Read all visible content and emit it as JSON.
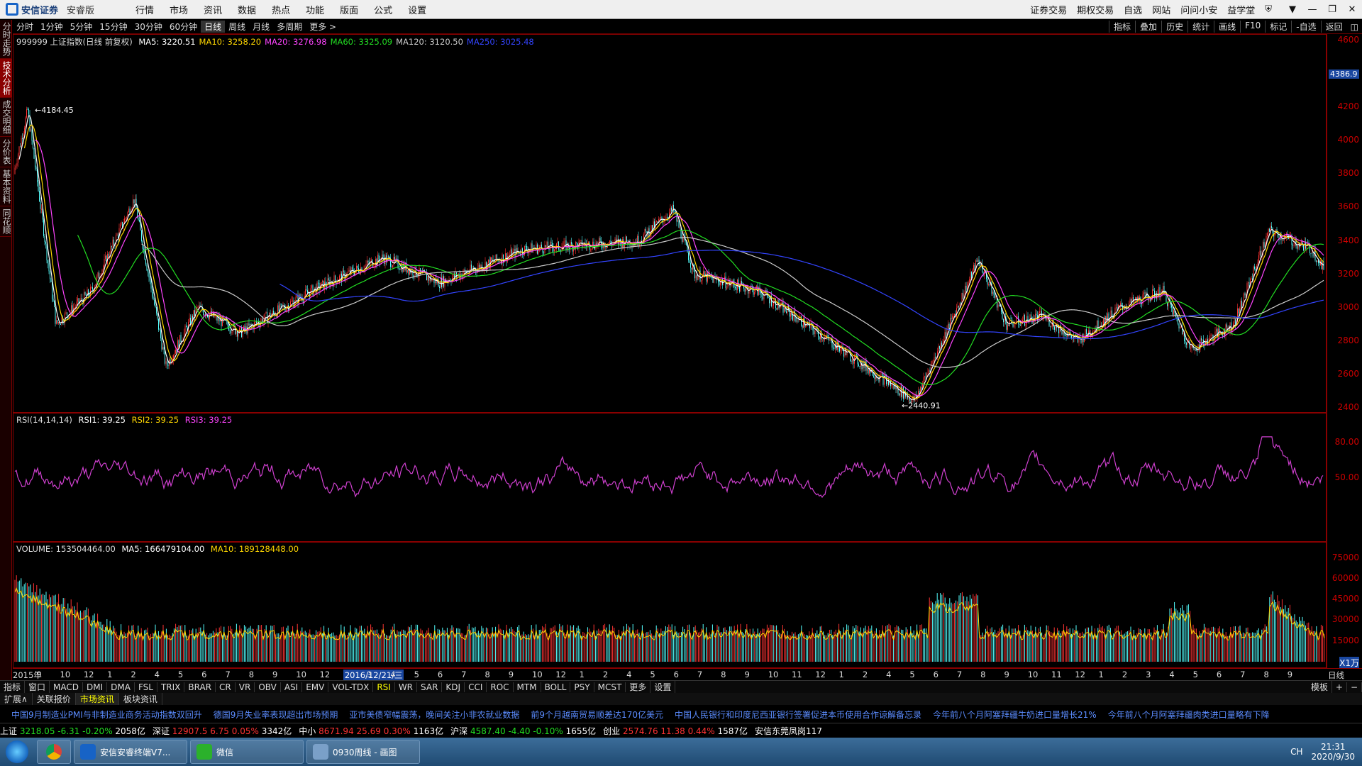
{
  "menubar": {
    "brand": "安信证券",
    "edition": "安睿版",
    "items": [
      "行情",
      "市场",
      "资讯",
      "数据",
      "热点",
      "功能",
      "版面",
      "公式",
      "设置"
    ],
    "right_items": [
      "证券交易",
      "期权交易",
      "自选",
      "网站",
      "问问小安",
      "益学堂"
    ],
    "window_controls": [
      "▼",
      "—",
      "❐",
      "✕"
    ]
  },
  "sidetabs": [
    {
      "label": "分时走势"
    },
    {
      "label": "技术分析",
      "active": true
    },
    {
      "label": "成交明细"
    },
    {
      "label": "分价表"
    },
    {
      "label": "基本资料"
    },
    {
      "label": "同花顺"
    }
  ],
  "periods": {
    "items": [
      "分时",
      "1分钟",
      "5分钟",
      "15分钟",
      "30分钟",
      "60分钟",
      "日线",
      "周线",
      "月线",
      "多周期",
      "更多 >"
    ],
    "active": "日线",
    "tools": [
      "指标",
      "叠加",
      "历史",
      "统计",
      "画线",
      "F10",
      "标记",
      "-自选",
      "返回"
    ]
  },
  "kline": {
    "stock": "999999 上证指数(日线 前复权)",
    "ma": [
      {
        "label": "MA5: 3220.51",
        "color": "#ffffff"
      },
      {
        "label": "MA10: 3258.20",
        "color": "#ffd700"
      },
      {
        "label": "MA20: 3276.98",
        "color": "#ff44ff"
      },
      {
        "label": "MA60: 3325.09",
        "color": "#22dd22"
      },
      {
        "label": "MA120: 3120.50",
        "color": "#cccccc"
      },
      {
        "label": "MA250: 3025.48",
        "color": "#3344ff"
      }
    ],
    "high_label": "4184.45",
    "low_label": "2440.91",
    "y_ticks": [
      "4600",
      "4400",
      "4200",
      "4000",
      "3800",
      "3600",
      "3400",
      "3200",
      "3000",
      "2800",
      "2600",
      "2400"
    ],
    "cursor_price": "4386.9"
  },
  "rsi": {
    "title": "RSI(14,14,14)",
    "rsi1": "RSI1: 39.25",
    "rsi2": "RSI2: 39.25",
    "rsi3": "RSI3: 39.25",
    "y_ticks": [
      "80.00",
      "50.00"
    ]
  },
  "volume": {
    "title": "VOLUME: 153504464.00",
    "ma5": "MA5: 166479104.00",
    "ma10": "MA10: 189128448.00",
    "y_ticks": [
      "75000",
      "60000",
      "45000",
      "30000",
      "15000"
    ],
    "unit": "X1万"
  },
  "date_axis": [
    "2015年",
    "9",
    "10",
    "12",
    "1",
    "2",
    "4",
    "5",
    "6",
    "7",
    "8",
    "9",
    "10",
    "12",
    "2016/12/21/三",
    "3",
    "4",
    "5",
    "6",
    "7",
    "8",
    "9",
    "10",
    "12",
    "1",
    "2",
    "4",
    "5",
    "6",
    "7",
    "8",
    "9",
    "10",
    "11",
    "12",
    "1",
    "2",
    "4",
    "5",
    "6",
    "7",
    "8",
    "9",
    "10",
    "11",
    "12",
    "1",
    "2",
    "3",
    "4",
    "5",
    "6",
    "7",
    "8",
    "9"
  ],
  "date_axis_right": "日线",
  "indicators": [
    "指标",
    "窗口",
    "MACD",
    "DMI",
    "DMA",
    "FSL",
    "TRIX",
    "BRAR",
    "CR",
    "VR",
    "OBV",
    "ASI",
    "EMV",
    "VOL-TDX",
    "RSI",
    "WR",
    "SAR",
    "KDJ",
    "CCI",
    "ROC",
    "MTM",
    "BOLL",
    "PSY",
    "MCST",
    "更多",
    "设置"
  ],
  "indicator_active": "RSI",
  "indbar_right": "模板",
  "newstabs": [
    "扩展∧",
    "关联报价",
    "市场资讯",
    "板块资讯"
  ],
  "newstab_active": "市场资讯",
  "ticker": [
    "中国9月制造业PMI与非制造业商务活动指数双回升",
    "德国9月失业率表现超出市场预期",
    "亚市美债窄幅震荡，晚间关注小非农就业数据",
    "前9个月越南贸易顺差达170亿美元",
    "中国人民银行和印度尼西亚银行签署促进本币使用合作谅解备忘录",
    "今年前八个月阿塞拜疆牛奶进口量增长21%",
    "今年前八个月阿塞拜疆肉类进口量略有下降"
  ],
  "indices": [
    {
      "name": "上证",
      "value": "3218.05",
      "chg": "-6.31",
      "pct": "-0.20%",
      "amt": "2058亿",
      "color": "green"
    },
    {
      "name": "深证",
      "value": "12907.5",
      "chg": "6.75",
      "pct": "0.05%",
      "amt": "3342亿",
      "color": "red"
    },
    {
      "name": "中小",
      "value": "8671.94",
      "chg": "25.69",
      "pct": "0.30%",
      "amt": "1163亿",
      "color": "red"
    },
    {
      "name": "沪深",
      "value": "4587.40",
      "chg": "-4.40",
      "pct": "-0.10%",
      "amt": "1655亿",
      "color": "green"
    },
    {
      "name": "创业",
      "value": "2574.76",
      "chg": "11.38",
      "pct": "0.44%",
      "amt": "1587亿",
      "color": "red"
    }
  ],
  "branch": "安信东莞凤岗117",
  "taskbar": {
    "apps": [
      "安信安睿终端V7...",
      "微信",
      "0930周线 - 画图"
    ],
    "lang": "CH",
    "time": "21:31",
    "date": "2020/9/30"
  },
  "chart_data": {
    "type": "candlestick",
    "series_note": "上证指数 daily, 2015-2020",
    "price_anchors": [
      {
        "x": "2015-08",
        "y": 4184.45
      },
      {
        "x": "2015-09",
        "y": 2900
      },
      {
        "x": "2015-12",
        "y": 3650
      },
      {
        "x": "2016-01",
        "y": 2650
      },
      {
        "x": "2016-11",
        "y": 3300
      },
      {
        "x": "2018-01",
        "y": 3587
      },
      {
        "x": "2019-01",
        "y": 2440.91
      },
      {
        "x": "2019-04",
        "y": 3288
      },
      {
        "x": "2020-07",
        "y": 3458
      },
      {
        "x": "2020-09",
        "y": 3218.05
      }
    ],
    "ylim": [
      2400,
      4600
    ]
  }
}
